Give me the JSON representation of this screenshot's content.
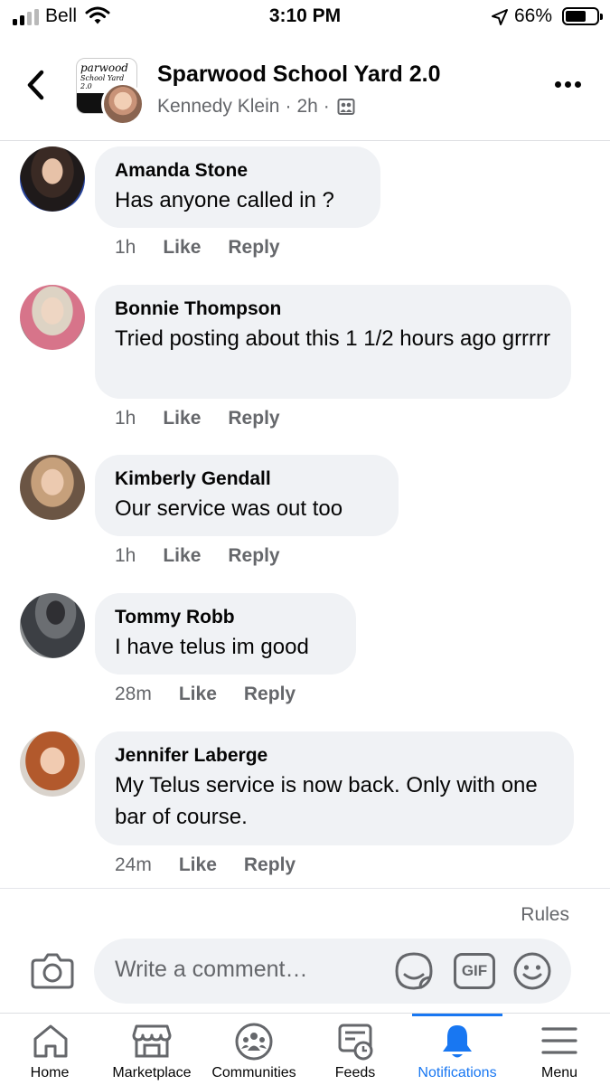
{
  "status": {
    "carrier": "Bell",
    "time": "3:10 PM",
    "battery": "66%",
    "battery_level": 0.66
  },
  "header": {
    "group_name": "Sparwood School Yard 2.0",
    "author": "Kennedy Klein",
    "time": "2h",
    "avatar_line1": "parwood",
    "avatar_line2": "School Yard 2.0"
  },
  "comments": [
    {
      "name": "Amanda Stone",
      "text": "Has anyone called in ?",
      "time": "1h",
      "like": "Like",
      "reply": "Reply"
    },
    {
      "name": "Bonnie Thompson",
      "text": "Tried posting about this 1 1/2 hours ago grrrrr",
      "time": "1h",
      "like": "Like",
      "reply": "Reply"
    },
    {
      "name": "Kimberly Gendall",
      "text": "Our service was out too",
      "time": "1h",
      "like": "Like",
      "reply": "Reply"
    },
    {
      "name": "Tommy Robb",
      "text": "I have telus im good",
      "time": "28m",
      "like": "Like",
      "reply": "Reply"
    },
    {
      "name": "Jennifer Laberge",
      "text": "My Telus service is now back. Only with one bar of course.",
      "time": "24m",
      "like": "Like",
      "reply": "Reply"
    }
  ],
  "composer": {
    "rules": "Rules",
    "placeholder": "Write a comment…",
    "gif": "GIF"
  },
  "tabs": [
    {
      "label": "Home",
      "icon": "home-icon"
    },
    {
      "label": "Marketplace",
      "icon": "marketplace-icon"
    },
    {
      "label": "Communities",
      "icon": "communities-icon"
    },
    {
      "label": "Feeds",
      "icon": "feeds-icon"
    },
    {
      "label": "Notifications",
      "icon": "bell-icon",
      "active": true
    },
    {
      "label": "Menu",
      "icon": "menu-icon"
    }
  ],
  "colors": {
    "accent": "#1877f2",
    "bubble": "#f0f2f5",
    "secondary_text": "#65676b"
  }
}
